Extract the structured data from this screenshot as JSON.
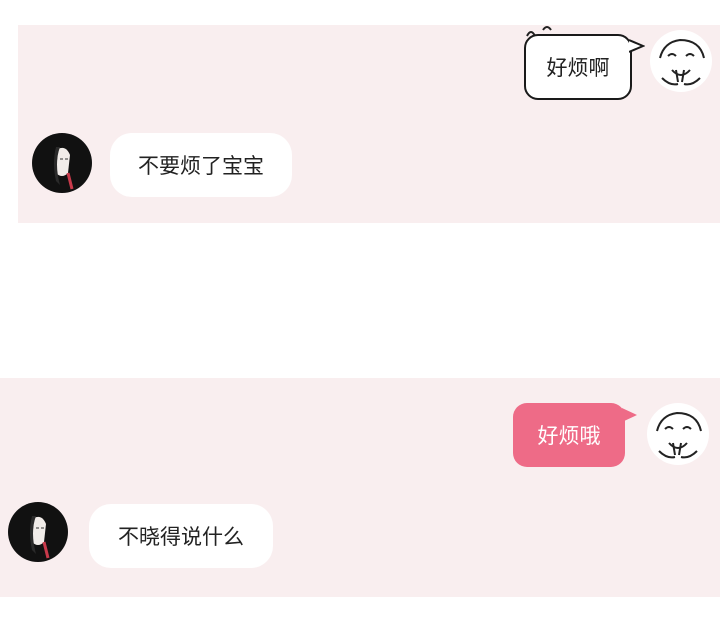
{
  "conversations": [
    {
      "user_message": "好烦啊",
      "reply_message": "不要烦了宝宝"
    },
    {
      "user_message": "好烦哦",
      "reply_message": "不晓得说什么"
    }
  ],
  "colors": {
    "panel_bg": "#f9eeef",
    "pink_bubble": "#ee6b87",
    "avatar_bg": "#111111"
  },
  "icons": {
    "user_avatar": "hand-drawn-face-icon",
    "contact_avatar": "portrait-avatar-icon",
    "annoyed_marks": "squiggle-icon"
  }
}
